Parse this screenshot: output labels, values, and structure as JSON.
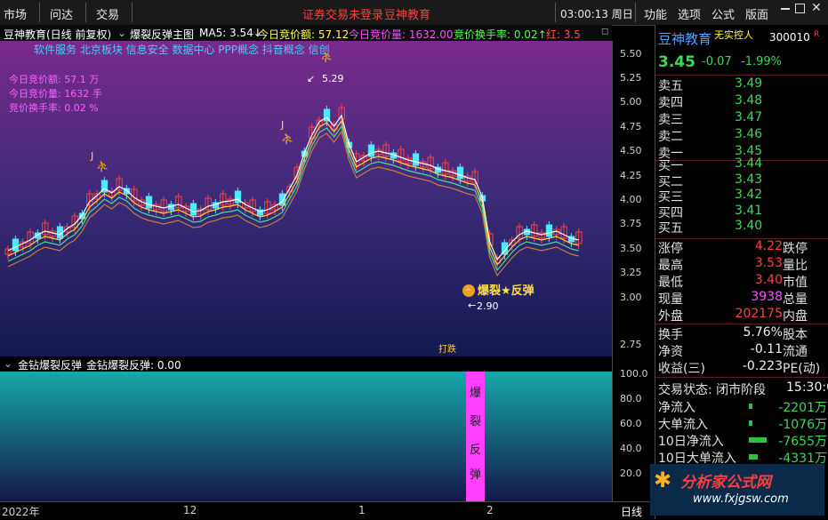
{
  "menu": {
    "left": [
      "市场",
      "问达",
      "交易"
    ],
    "notice_login": "证券交易未登录",
    "notice_brand": "豆神教育",
    "clock": "03:00:13 周日",
    "right": [
      "功能",
      "选项",
      "公式",
      "版面"
    ]
  },
  "chart_header": {
    "title": "豆神教育(日线 前复权)",
    "indicator": "爆裂反弹主图",
    "ma5": "MA5: 3.54↓",
    "auction_amount": "今日竞价额: 57.12",
    "auction_volume": "今日竞价量: 1632.00",
    "auction_turnover": "竞价换手率: 0.02↑",
    "red": "红: 3.5"
  },
  "concepts": "软件服务 北京板块 信息安全 数据中心 PPP概念 抖音概念 信创",
  "overlay_info": [
    "今日竞价额: 57.1 万",
    "今日竞价量: 1632 手",
    "竞价换手率: 0.02 %"
  ],
  "annotations": {
    "high": "5.29",
    "low": "2.90",
    "signal": "爆裂★反弹",
    "small_signal": "打跌",
    "j_marks": [
      "J",
      "J"
    ]
  },
  "y_ticks": [
    "5.50",
    "5.25",
    "5.00",
    "4.75",
    "4.50",
    "4.25",
    "4.00",
    "3.75",
    "3.50",
    "3.25",
    "3.00",
    "2.75"
  ],
  "sub_header": {
    "name": "金钻爆裂反弹",
    "value": "金钻爆裂反弹: 0.00"
  },
  "sub_y_ticks": [
    "100.0",
    "80.0",
    "60.0",
    "40.0",
    "20.0"
  ],
  "sub_bar_text": [
    "爆",
    "裂",
    "反",
    "弹"
  ],
  "time_ticks": [
    "2022年",
    "12",
    "1",
    "2"
  ],
  "time_axis_label": "日线",
  "panel": {
    "name": "豆神教育",
    "tag": "无实控人",
    "code": "300010",
    "code_mark": "R",
    "price": "3.45",
    "change": "-0.07",
    "change_pct": "-1.99%",
    "asks": [
      {
        "label": "卖五",
        "price": "3.49"
      },
      {
        "label": "卖四",
        "price": "3.48"
      },
      {
        "label": "卖三",
        "price": "3.47"
      },
      {
        "label": "卖二",
        "price": "3.46"
      },
      {
        "label": "卖一",
        "price": "3.45"
      }
    ],
    "bids": [
      {
        "label": "买一",
        "price": "3.44"
      },
      {
        "label": "买二",
        "price": "3.43"
      },
      {
        "label": "买三",
        "price": "3.42"
      },
      {
        "label": "买四",
        "price": "3.41"
      },
      {
        "label": "买五",
        "price": "3.40"
      }
    ],
    "stats": [
      {
        "label": "涨停",
        "value": "4.22",
        "label2": "跌停"
      },
      {
        "label": "最高",
        "value": "3.53",
        "label2": "量比"
      },
      {
        "label": "最低",
        "value": "3.40",
        "label2": "市值"
      },
      {
        "label": "现量",
        "value": "3938",
        "label2": "总量"
      },
      {
        "label": "外盘",
        "value": "202175",
        "label2": "内盘"
      }
    ],
    "stats2": [
      {
        "label": "换手",
        "value": "5.76%",
        "label2": "股本"
      },
      {
        "label": "净资",
        "value": "-0.11",
        "label2": "流通"
      },
      {
        "label": "收益(三)",
        "value": "-0.223",
        "label2": "PE(动)"
      }
    ],
    "trade_status_label": "交易状态: 闭市阶段",
    "trade_time": "15:30:0",
    "flows": [
      {
        "label": "净流入",
        "value": "-2201万"
      },
      {
        "label": "大单流入",
        "value": "-1076万"
      },
      {
        "label": "10日净流入",
        "value": "-7655万"
      },
      {
        "label": "10日大单流入",
        "value": "-4331万"
      }
    ],
    "logo_text": "分析家公式网",
    "logo_url": "www.fxjgsw.com"
  }
}
